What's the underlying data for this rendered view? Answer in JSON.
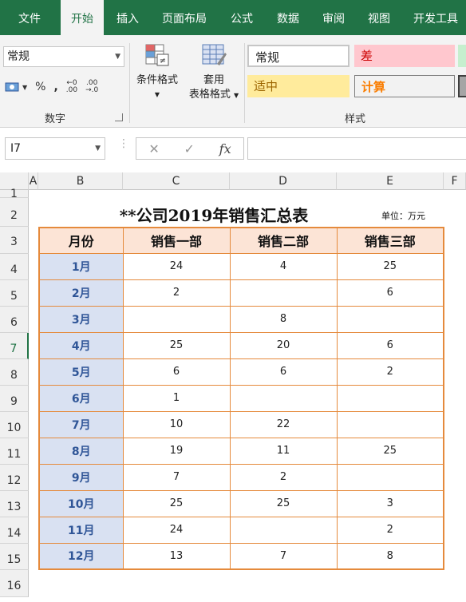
{
  "ribbon": {
    "tabs": [
      "文件",
      "开始",
      "插入",
      "页面布局",
      "公式",
      "数据",
      "审阅",
      "视图",
      "开发工具"
    ],
    "active_tab": "开始",
    "number_format": "常规",
    "number_group_label": "数字",
    "cond_format_label": "条件格式",
    "table_format_label_1": "套用",
    "table_format_label_2": "表格格式",
    "styles": {
      "normal": "常规",
      "bad": "差",
      "neutral": "适中",
      "calc": "计算"
    },
    "styles_group_label": "样式"
  },
  "formula_bar": {
    "name_box": "I7",
    "cancel": "✕",
    "enter": "✓",
    "fx": "fx",
    "value": ""
  },
  "grid": {
    "columns": [
      "A",
      "B",
      "C",
      "D",
      "E",
      "F"
    ],
    "rows": [
      "1",
      "2",
      "3",
      "4",
      "5",
      "6",
      "7",
      "8",
      "9",
      "10",
      "11",
      "12",
      "13",
      "14",
      "15",
      "16"
    ]
  },
  "sheet": {
    "title": "**公司2019年销售汇总表",
    "unit": "单位：万元",
    "headers": [
      "月份",
      "销售一部",
      "销售二部",
      "销售三部"
    ],
    "rows": [
      {
        "month": "1月",
        "d1": "24",
        "d2": "4",
        "d3": "25"
      },
      {
        "month": "2月",
        "d1": "2",
        "d2": "",
        "d3": "6"
      },
      {
        "month": "3月",
        "d1": "",
        "d2": "8",
        "d3": ""
      },
      {
        "month": "4月",
        "d1": "25",
        "d2": "20",
        "d3": "6"
      },
      {
        "month": "5月",
        "d1": "6",
        "d2": "6",
        "d3": "2"
      },
      {
        "month": "6月",
        "d1": "1",
        "d2": "",
        "d3": ""
      },
      {
        "month": "7月",
        "d1": "10",
        "d2": "22",
        "d3": ""
      },
      {
        "month": "8月",
        "d1": "19",
        "d2": "11",
        "d3": "25"
      },
      {
        "month": "9月",
        "d1": "7",
        "d2": "2",
        "d3": ""
      },
      {
        "month": "10月",
        "d1": "25",
        "d2": "25",
        "d3": "3"
      },
      {
        "month": "11月",
        "d1": "24",
        "d2": "",
        "d3": "2"
      },
      {
        "month": "12月",
        "d1": "13",
        "d2": "7",
        "d3": "8"
      }
    ]
  },
  "colors": {
    "ribbon_green": "#217346",
    "header_fill": "#fce4d6",
    "month_fill": "#d9e1f2",
    "border_orange": "#e58a3c",
    "month_text": "#2f5597"
  }
}
